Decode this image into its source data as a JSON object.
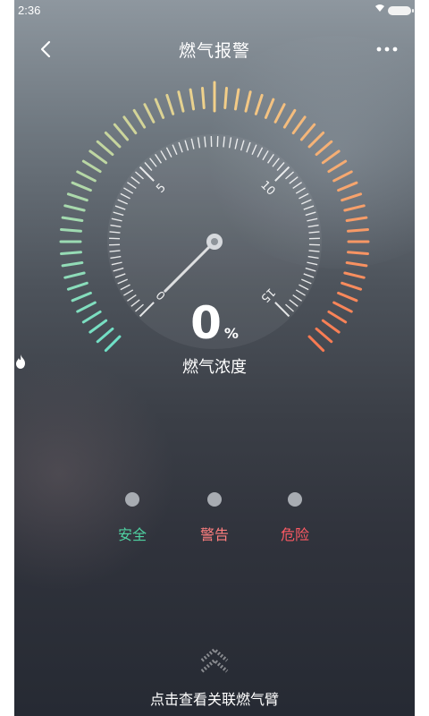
{
  "status_bar": {
    "time": "2:36",
    "wifi_icon": "wifi-icon",
    "battery_icon": "battery-icon"
  },
  "header": {
    "title": "燃气报警",
    "back_icon": "chevron-left-icon",
    "more_icon": "more-dots-icon"
  },
  "gauge": {
    "value": "0",
    "unit": "%",
    "label": "燃气浓度",
    "label_icon": "flame-icon",
    "scale_labels": [
      "0",
      "5",
      "10",
      "15"
    ],
    "scale_min": 0,
    "scale_max": 15,
    "current_value": 0,
    "colors": {
      "safe": "#6fe0c7",
      "mid": "#f2d08a",
      "danger": "#fa7a52"
    }
  },
  "levels": [
    {
      "label": "安全",
      "color": "#4fd1a1"
    },
    {
      "label": "警告",
      "color": "#ff7f7f"
    },
    {
      "label": "危险",
      "color": "#ff5a64"
    }
  ],
  "footer": {
    "text": "点击查看关联燃气臂",
    "icon": "double-chevron-up-icon"
  }
}
